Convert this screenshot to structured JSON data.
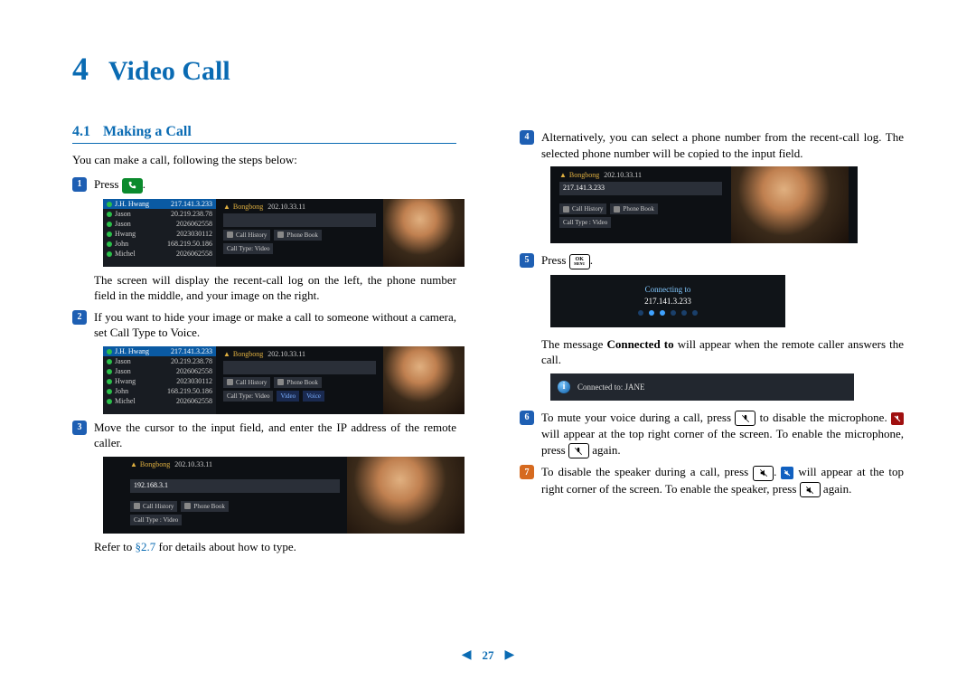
{
  "chapter": {
    "number": "4",
    "title": "Video Call"
  },
  "section": {
    "number": "4.1",
    "title": "Making a Call"
  },
  "intro": "You can make a call, following the steps below:",
  "steps": {
    "s1": {
      "n": "1",
      "text": "Press "
    },
    "s1_post": ".",
    "s1_note": "The screen will display the recent-call log on the left, the phone number field in the middle, and your image on the right.",
    "s2": {
      "n": "2",
      "text": "If you want to hide your image or make a call to someone without a camera, set Call Type to Voice."
    },
    "s3": {
      "n": "3",
      "text": "Move the cursor to the input field, and enter the IP address of the remote caller."
    },
    "s3_note_a": "Refer to ",
    "s3_note_link": "§2.7",
    "s3_note_b": " for details about how to type.",
    "s4": {
      "n": "4",
      "text": "Alternatively, you can select a phone number from the recent-call log. The selected phone number will be copied to the input field."
    },
    "s5": {
      "n": "5",
      "text": "Press "
    },
    "s5_post": ".",
    "s5_note_a": "The message ",
    "s5_note_bold": "Connected to",
    "s5_note_b": " will appear when the remote caller answers the call.",
    "s6": {
      "n": "6",
      "a": "To mute your voice during a call, press ",
      "b": " to disable the microphone. ",
      "c": " will appear at the top right corner of the screen. To enable the microphone, press ",
      "d": " again."
    },
    "s7": {
      "n": "7",
      "a": "To disable the speaker during a call, press ",
      "b": ". ",
      "c": " will appear at the top right corner of the screen. To enable the speaker, press ",
      "d": " again."
    }
  },
  "keys": {
    "call": "CALL",
    "ok_top": "OK",
    "ok_bot": "MENU"
  },
  "shot": {
    "top_name": "Bongbong",
    "top_ip": "202.10.33.11",
    "hdr_name": "J.H. Hwang",
    "hdr_ip": "217.141.3.233",
    "log": [
      {
        "name": "Jason",
        "val": "20.219.238.78"
      },
      {
        "name": "Jason",
        "val": "2026062558"
      },
      {
        "name": "Hwang",
        "val": "2023030112"
      },
      {
        "name": "John",
        "val": "168.219.50.186"
      },
      {
        "name": "Michel",
        "val": "2026062558"
      }
    ],
    "btn_history": "Call History",
    "btn_book": "Phone Book",
    "calltype_label": "Call Type: Video",
    "voice": "Video",
    "voice2": "Voice",
    "ip_input": "192.168.3.1",
    "ip_copied": "217.141.3.233",
    "calltype_video": "Call Type : Video"
  },
  "connecting": {
    "label": "Connecting to",
    "ip": "217.141.3.233"
  },
  "connected": {
    "label": "Connected to: JANE"
  },
  "footer": {
    "page": "27"
  }
}
